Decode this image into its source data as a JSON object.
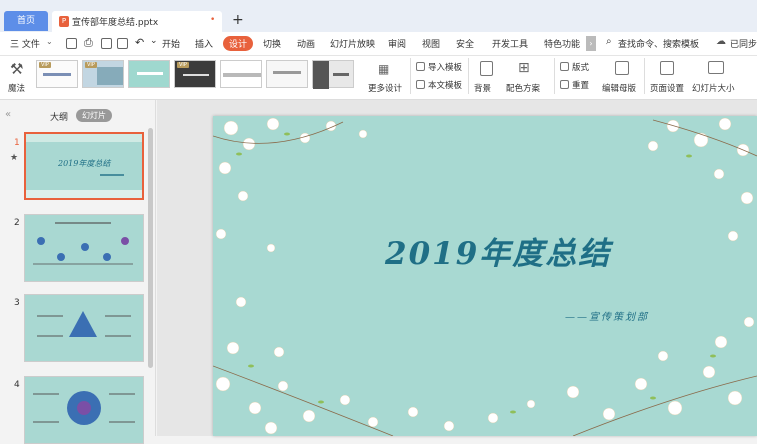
{
  "tabs": {
    "home": "首页",
    "file_name": "宣传部年度总结.pptx",
    "modified_mark": "•",
    "new_tab": "+"
  },
  "menu": {
    "file": "三 文件",
    "items": [
      "开始",
      "插入",
      "设计",
      "切换",
      "动画",
      "幻灯片放映",
      "审阅",
      "视图",
      "安全",
      "开发工具",
      "特色功能"
    ],
    "active": "设计",
    "search": "查找命令、搜索模板",
    "sync": "已同步"
  },
  "ribbon": {
    "magic": "魔法",
    "more_design": "更多设计",
    "import_template": "导入模板",
    "this_template": "本文模板",
    "background": "背景",
    "color_scheme": "配色方案",
    "layout": "版式",
    "reset": "重置",
    "edit_master": "编辑母版",
    "page_setup": "页面设置",
    "slide_size": "幻灯片大小",
    "vip": "VIP"
  },
  "left_panel": {
    "collapse": "«",
    "outline": "大纲",
    "slides": "幻灯片",
    "slide_numbers": [
      "1",
      "2",
      "3",
      "4"
    ],
    "thumb1_title": "2019年度总结"
  },
  "slide": {
    "title": "2019年度总结",
    "subtitle": "——宣传策划部",
    "bg_color": "#a8d9d2",
    "text_color": "#1f6f86"
  },
  "colors": {
    "accent": "#e8613c",
    "home_tab": "#5d8ee8"
  }
}
